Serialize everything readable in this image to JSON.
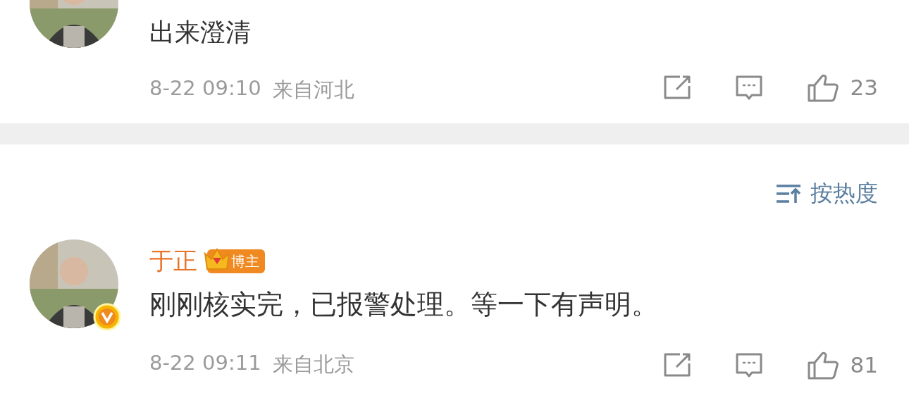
{
  "previous_comment": {
    "text": "出来澄清",
    "time": "8-22 09:10",
    "location": "来自河北",
    "likes": "23"
  },
  "sort": {
    "label": "按热度"
  },
  "comments": [
    {
      "verified": true,
      "author": "于正",
      "badge": "博主",
      "text": "刚刚核实完，已报警处理。等一下有声明。",
      "time": "8-22 09:11",
      "location": "来自北京",
      "likes": "81"
    }
  ]
}
